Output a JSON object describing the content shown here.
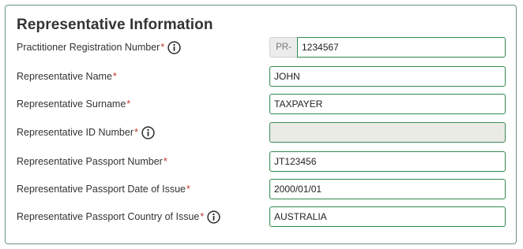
{
  "section": {
    "title": "Representative Information"
  },
  "fields": [
    {
      "label": "Practitioner Registration Number",
      "required_mark": "*",
      "has_info": true,
      "prefix": "PR-",
      "value": "1234567"
    },
    {
      "label": "Representative Name",
      "required_mark": "*",
      "has_info": false,
      "value": "JOHN"
    },
    {
      "label": "Representative Surname",
      "required_mark": "*",
      "has_info": false,
      "value": "TAXPAYER"
    },
    {
      "label": "Representative ID Number",
      "required_mark": "*",
      "has_info": true,
      "value": "",
      "disabled": true
    },
    {
      "label": "Representative Passport Number",
      "required_mark": "*",
      "has_info": false,
      "value": "JT123456"
    },
    {
      "label": "Representative Passport Date of Issue",
      "required_mark": "*",
      "has_info": false,
      "value": "2000/01/01"
    },
    {
      "label": "Representative Passport Country of Issue",
      "required_mark": "*",
      "has_info": true,
      "value": "AUSTRALIA"
    }
  ],
  "icons": {
    "info": "info-circle-icon"
  },
  "colors": {
    "input_border": "#2f8a4a",
    "panel_border": "#6a8f86",
    "required": "#c0392b",
    "disabled_bg": "#ebebe6",
    "prefix_bg": "#ececec"
  }
}
